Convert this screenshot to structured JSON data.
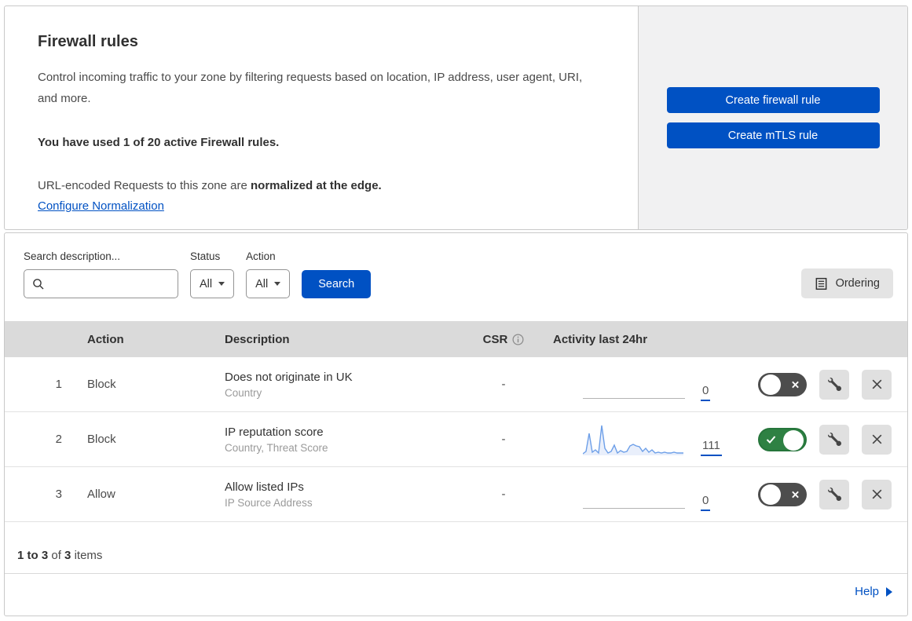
{
  "header": {
    "title": "Firewall rules",
    "description": "Control incoming traffic to your zone by filtering requests based on location, IP address, user agent, URI, and more.",
    "usage_bold": "You have used 1 of 20 active Firewall rules.",
    "normalization_text": "URL-encoded Requests to this zone are ",
    "normalization_bold": "normalized at the edge.",
    "normalization_link": "Configure Normalization",
    "create_firewall_label": "Create firewall rule",
    "create_mtls_label": "Create mTLS rule"
  },
  "filters": {
    "search_label": "Search description...",
    "search_value": "",
    "status_label": "Status",
    "status_value": "All",
    "action_label": "Action",
    "action_value": "All",
    "search_button": "Search",
    "ordering_button": "Ordering"
  },
  "table": {
    "columns": {
      "action": "Action",
      "description": "Description",
      "csr": "CSR",
      "activity": "Activity last 24hr"
    },
    "rows": [
      {
        "index": "1",
        "action": "Block",
        "description": "Does not originate in UK",
        "fields": "Country",
        "csr": "-",
        "activity_count": "0",
        "enabled": false
      },
      {
        "index": "2",
        "action": "Block",
        "description": "IP reputation score",
        "fields": "Country, Threat Score",
        "csr": "-",
        "activity_count": "111",
        "enabled": true
      },
      {
        "index": "3",
        "action": "Allow",
        "description": "Allow listed IPs",
        "fields": "IP Source Address",
        "csr": "-",
        "activity_count": "0",
        "enabled": false
      }
    ]
  },
  "sparkline": {
    "line": "0,39 4,36 8,13 12,37 16,34 20,38 24,3 28,32 32,38 36,36 40,28 44,38 48,35 52,37 56,36 60,29 64,27 68,29 72,30 76,36 80,32 84,37 88,34 92,38 96,37 100,38 104,37 108,38 112,38 116,37 120,38 124,38 128,38",
    "fill": "0,41 0,39 4,36 8,13 12,37 16,34 20,38 24,3 28,32 32,38 36,36 40,28 44,38 48,35 52,37 56,36 60,29 64,27 68,29 72,30 76,36 80,32 84,37 88,34 92,38 96,37 100,38 104,37 108,38 112,38 116,37 120,38 124,38 128,38 128,41"
  },
  "footer": {
    "range_bold": "1 to 3",
    "of_text": "of",
    "total_bold": "3",
    "items_text": "items",
    "help_label": "Help"
  },
  "colors": {
    "accent_blue": "#0051c3",
    "panel_gray": "#f1f1f2",
    "table_header_gray": "#dadada",
    "toggle_on_green": "#2e8143",
    "toggle_off_gray": "#4d4d4d",
    "sparkline_blue": "#6d9fe8",
    "sparkline_fill": "#e9effb"
  },
  "icons": {
    "search": "magnifier-glyph",
    "dropdown": "down-caret",
    "ordering": "list-document",
    "info": "circled-i",
    "wrench": "wrench",
    "close": "x-cross",
    "toggle_off_glyph": "x-cross",
    "toggle_on_glyph": "checkmark",
    "help_arrow": "right-triangle"
  }
}
